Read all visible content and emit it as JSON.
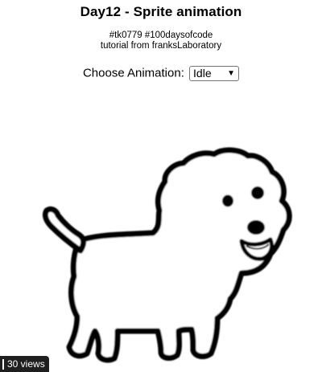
{
  "header": {
    "title": "Day12 - Sprite animation",
    "subtitle_line1": "#tk0779 #100daysofcode",
    "subtitle_line2": "tutorial from franksLaboratory"
  },
  "controls": {
    "label": "Choose Animation:",
    "selected": "Idle",
    "chevron": "⌄"
  },
  "sprite": {
    "icon": "dog-sprite",
    "outline_color": "#000000",
    "fill_color": "#ffffff"
  },
  "footer": {
    "views": "30 views"
  }
}
